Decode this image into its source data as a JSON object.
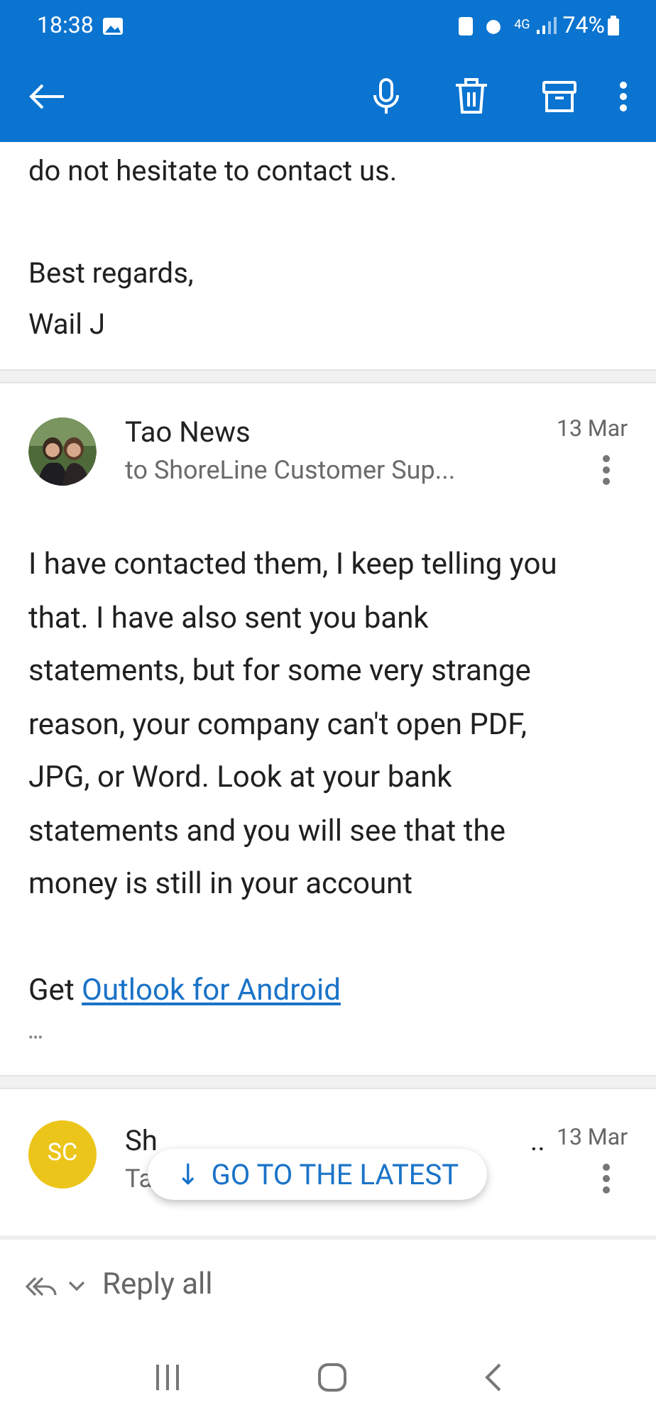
{
  "status_bar": {
    "time": "18:38",
    "network": "4G",
    "battery": "74%"
  },
  "previous_message": {
    "closing": "do not hesitate to contact us.",
    "sign_off": [
      "Best regards,",
      "Wail J"
    ]
  },
  "message": {
    "sender": "Tao News",
    "recipients": "to ShoreLine Customer Sup...",
    "date": "13 Mar",
    "body": "I have contacted them, I keep telling you that. I have also sent you bank statements, but for some very strange reason, your company can't open PDF, JPG, or Word. Look at your bank statements and you will see that the money is still in your account",
    "signature_prefix": "Get ",
    "signature_link": "Outlook for Android",
    "more": "•••"
  },
  "next_message": {
    "initials": "SC",
    "sender": "Sh",
    "ellipsis": "..",
    "subtitle": "Ta",
    "date": "13 Mar"
  },
  "latest_button": {
    "arrow": "↓",
    "label": "GO TO THE LATEST"
  },
  "reply_bar": {
    "label": "Reply all"
  }
}
